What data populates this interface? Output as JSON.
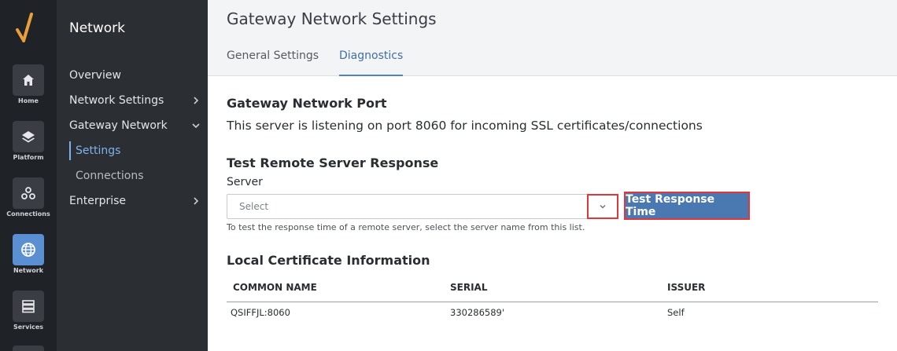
{
  "rail": {
    "items": [
      {
        "label": "Home",
        "icon": "home-icon"
      },
      {
        "label": "Platform",
        "icon": "layers-icon"
      },
      {
        "label": "Connections",
        "icon": "connections-icon"
      },
      {
        "label": "Network",
        "icon": "globe-icon",
        "active": true
      },
      {
        "label": "Services",
        "icon": "services-icon"
      }
    ]
  },
  "nav": {
    "title": "Network",
    "items": [
      {
        "label": "Overview"
      },
      {
        "label": "Network Settings",
        "icon": "chevron-right-icon"
      },
      {
        "label": "Gateway Network",
        "icon": "chevron-down-icon"
      },
      {
        "label": "Settings",
        "active": true
      },
      {
        "label": "Connections"
      },
      {
        "label": "Enterprise",
        "icon": "chevron-right-icon"
      }
    ]
  },
  "header": {
    "title": "Gateway Network Settings",
    "tabs": [
      {
        "label": "General Settings"
      },
      {
        "label": "Diagnostics",
        "active": true
      }
    ]
  },
  "port_section": {
    "heading": "Gateway Network Port",
    "text": "This server is listening on port 8060 for incoming SSL certificates/connections"
  },
  "test_section": {
    "heading": "Test Remote Server Response",
    "server_label": "Server",
    "select_placeholder": "Select",
    "button_label": "Test Response Time",
    "hint": "To test the response time of a remote server, select the server name from this list."
  },
  "cert_section": {
    "heading": "Local Certificate Information",
    "columns": [
      "COMMON NAME",
      "SERIAL",
      "ISSUER"
    ],
    "rows": [
      [
        "QSIFFJL:8060",
        "330286589'",
        "Self"
      ]
    ]
  },
  "colors": {
    "accent": "#4a78b0",
    "active_rail": "#5a8fd1",
    "highlight_border": "#e0363c"
  }
}
